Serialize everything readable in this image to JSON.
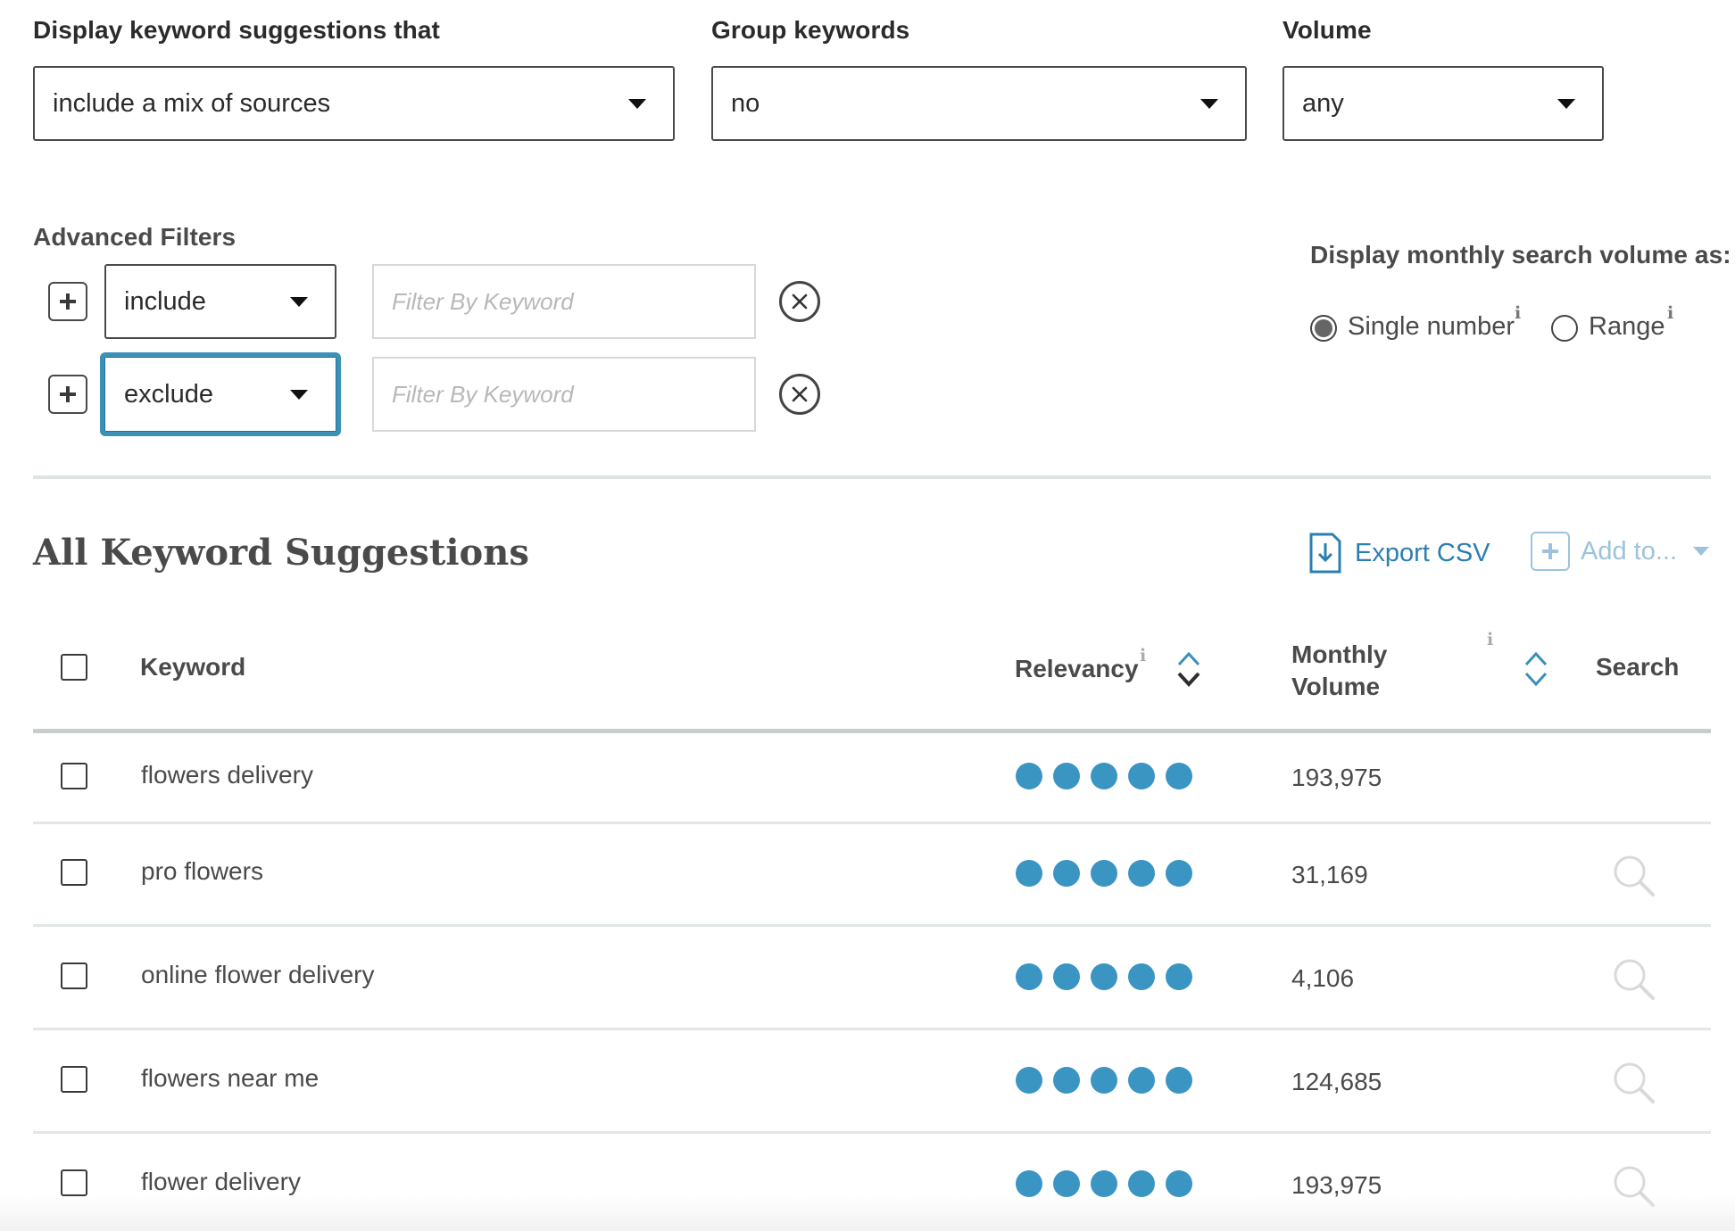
{
  "top_filters": {
    "display_label": "Display keyword suggestions that",
    "display_value": "include a mix of sources",
    "group_label": "Group keywords",
    "group_value": "no",
    "volume_label": "Volume",
    "volume_value": "any"
  },
  "advanced": {
    "title": "Advanced Filters",
    "rows": [
      {
        "mode": "include",
        "placeholder": "Filter By Keyword"
      },
      {
        "mode": "exclude",
        "placeholder": "Filter By Keyword"
      }
    ]
  },
  "volume_display": {
    "label": "Display monthly search volume as:",
    "options": [
      {
        "label": "Single number",
        "selected": true
      },
      {
        "label": "Range",
        "selected": false
      }
    ],
    "info_glyph": "i"
  },
  "suggestions": {
    "title": "All Keyword Suggestions",
    "export_label": "Export CSV",
    "add_label": "Add to...",
    "columns": {
      "keyword": "Keyword",
      "relevancy": "Relevancy",
      "monthly_line1": "Monthly",
      "monthly_line2": "Volume",
      "search": "Search"
    },
    "rows": [
      {
        "keyword": "flowers delivery",
        "relevancy": 5,
        "volume": "193,975"
      },
      {
        "keyword": "pro flowers",
        "relevancy": 5,
        "volume": "31,169"
      },
      {
        "keyword": "online flower delivery",
        "relevancy": 5,
        "volume": "4,106"
      },
      {
        "keyword": "flowers near me",
        "relevancy": 5,
        "volume": "124,685"
      },
      {
        "keyword": "flower delivery",
        "relevancy": 5,
        "volume": "193,975"
      }
    ]
  },
  "colors": {
    "accent": "#3a95c2",
    "link": "#2b7fb0",
    "focus": "#3c91b6"
  },
  "icons": [
    "plus-icon",
    "close-circle-icon",
    "caret-down-icon",
    "sort-icon",
    "export-icon",
    "add-icon",
    "search-icon",
    "info-icon"
  ]
}
